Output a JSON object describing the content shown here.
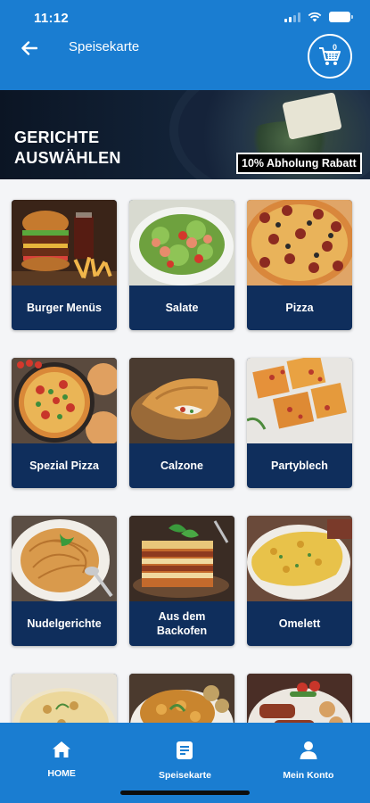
{
  "status_bar": {
    "time": "11:12"
  },
  "header": {
    "title": "Speisekarte",
    "cart_count": "0"
  },
  "banner": {
    "title_line1": "GERICHTE",
    "title_line2": "AUSWÄHLEN",
    "badge": "10% Abholung Rabatt"
  },
  "categories": [
    {
      "label": "Burger Menüs",
      "image": "burger-menu-photo"
    },
    {
      "label": "Salate",
      "image": "salad-photo"
    },
    {
      "label": "Pizza",
      "image": "pizza-photo"
    },
    {
      "label": "Spezial Pizza",
      "image": "special-pizza-photo"
    },
    {
      "label": "Calzone",
      "image": "calzone-photo"
    },
    {
      "label": "Partyblech",
      "image": "party-tray-photo"
    },
    {
      "label": "Nudelgerichte",
      "image": "pasta-photo"
    },
    {
      "label": "Aus dem Backofen",
      "image": "lasagna-photo"
    },
    {
      "label": "Omelett",
      "image": "omelette-photo"
    },
    {
      "label": "",
      "image": "casserole-photo"
    },
    {
      "label": "",
      "image": "schnitzel-photo"
    },
    {
      "label": "",
      "image": "grill-plate-photo"
    }
  ],
  "bottom_nav": [
    {
      "label": "HOME",
      "icon": "home-icon"
    },
    {
      "label": "Speisekarte",
      "icon": "menu-icon"
    },
    {
      "label": "Mein Konto",
      "icon": "person-icon"
    }
  ],
  "colors": {
    "primary": "#1a7dd1",
    "card": "#0f2e5c",
    "background": "#f4f5f7"
  }
}
